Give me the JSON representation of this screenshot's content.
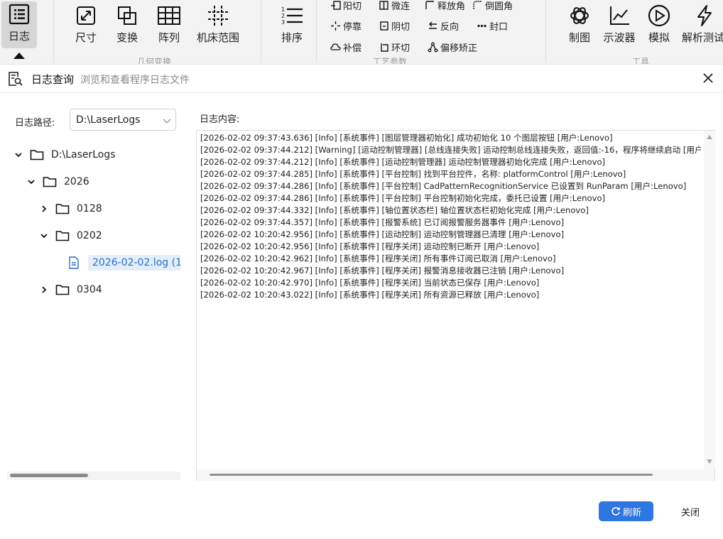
{
  "ribbon": {
    "log_button": "日志",
    "geometry": {
      "size": "尺寸",
      "transform": "变换",
      "array": "阵列",
      "machine_range": "机床范围",
      "group_label": "几何变换"
    },
    "sort": "排序",
    "process": {
      "row1": [
        "阳切",
        "微连",
        "释放角",
        "倒圆角"
      ],
      "row2": [
        "停靠",
        "阴切",
        "反向",
        "封口"
      ],
      "row3": [
        "补偿",
        "环切",
        "偏移矫正"
      ],
      "group_label": "工艺参数"
    },
    "tools": {
      "drawing": "制图",
      "oscilloscope": "示波器",
      "simulate": "模拟",
      "parse_test": "解析测试",
      "group_label": "工具"
    }
  },
  "dialog": {
    "title": "日志查询",
    "subtitle": "浏览和查看程序日志文件",
    "path_label": "日志路径:",
    "path_value": "D:\\LaserLogs",
    "tree": {
      "root": "D:\\LaserLogs",
      "year": "2026",
      "folder_0128": "0128",
      "folder_0202": "0202",
      "file": "2026-02-02.log (1.",
      "folder_0304": "0304"
    },
    "content_label": "日志内容:",
    "log_lines": [
      "[2026-02-02 09:37:43.636] [Info] [系统事件] [图层管理器初始化] 成功初始化 10 个图层按钮 [用户:Lenovo]",
      "[2026-02-02 09:37:44.212] [Warning] [运动控制管理器] [总线连接失败] 运动控制总线连接失败，返回值:-16，程序将继续启动 [用户",
      "[2026-02-02 09:37:44.212] [Info] [系统事件] [运动控制管理器] 运动控制管理器初始化完成 [用户:Lenovo]",
      "[2026-02-02 09:37:44.285] [Info] [系统事件] [平台控制] 找到平台控件，名称: platformControl [用户:Lenovo]",
      "[2026-02-02 09:37:44.286] [Info] [系统事件] [平台控制] CadPatternRecognitionService 已设置到 RunParam [用户:Lenovo]",
      "[2026-02-02 09:37:44.286] [Info] [系统事件] [平台控制] 平台控制初始化完成，委托已设置 [用户:Lenovo]",
      "[2026-02-02 09:37:44.332] [Info] [系统事件] [轴位置状态栏] 轴位置状态栏初始化完成 [用户:Lenovo]",
      "[2026-02-02 09:37:44.357] [Info] [系统事件] [报警系统] 已订阅报警服务器事件 [用户:Lenovo]",
      "[2026-02-02 10:20:42.956] [Info] [系统事件] [运动控制] 运动控制管理器已清理 [用户:Lenovo]",
      "[2026-02-02 10:20:42.956] [Info] [系统事件] [程序关闭] 运动控制已断开 [用户:Lenovo]",
      "[2026-02-02 10:20:42.962] [Info] [系统事件] [程序关闭] 所有事件订阅已取消 [用户:Lenovo]",
      "[2026-02-02 10:20:42.967] [Info] [系统事件] [程序关闭] 报警消息接收器已注销 [用户:Lenovo]",
      "[2026-02-02 10:20:42.970] [Info] [系统事件] [程序关闭] 当前状态已保存 [用户:Lenovo]",
      "[2026-02-02 10:20:43.022] [Info] [系统事件] [程序关闭] 所有资源已释放 [用户:Lenovo]"
    ],
    "refresh_button": "刷新",
    "close_button": "关闭"
  },
  "colors": {
    "accent": "#2f76e0",
    "selection_bg": "#e3eefa",
    "selection_text": "#2c6fc4"
  },
  "icons": [
    "list-icon",
    "resize-icon",
    "transform-icon",
    "grid-icon",
    "crosshair-grid-icon",
    "sort-icon",
    "openai-icon",
    "chart-line-icon",
    "play-circle-icon",
    "lightning-icon",
    "log-search-icon",
    "close-icon",
    "folder-icon",
    "file-icon",
    "refresh-icon"
  ]
}
